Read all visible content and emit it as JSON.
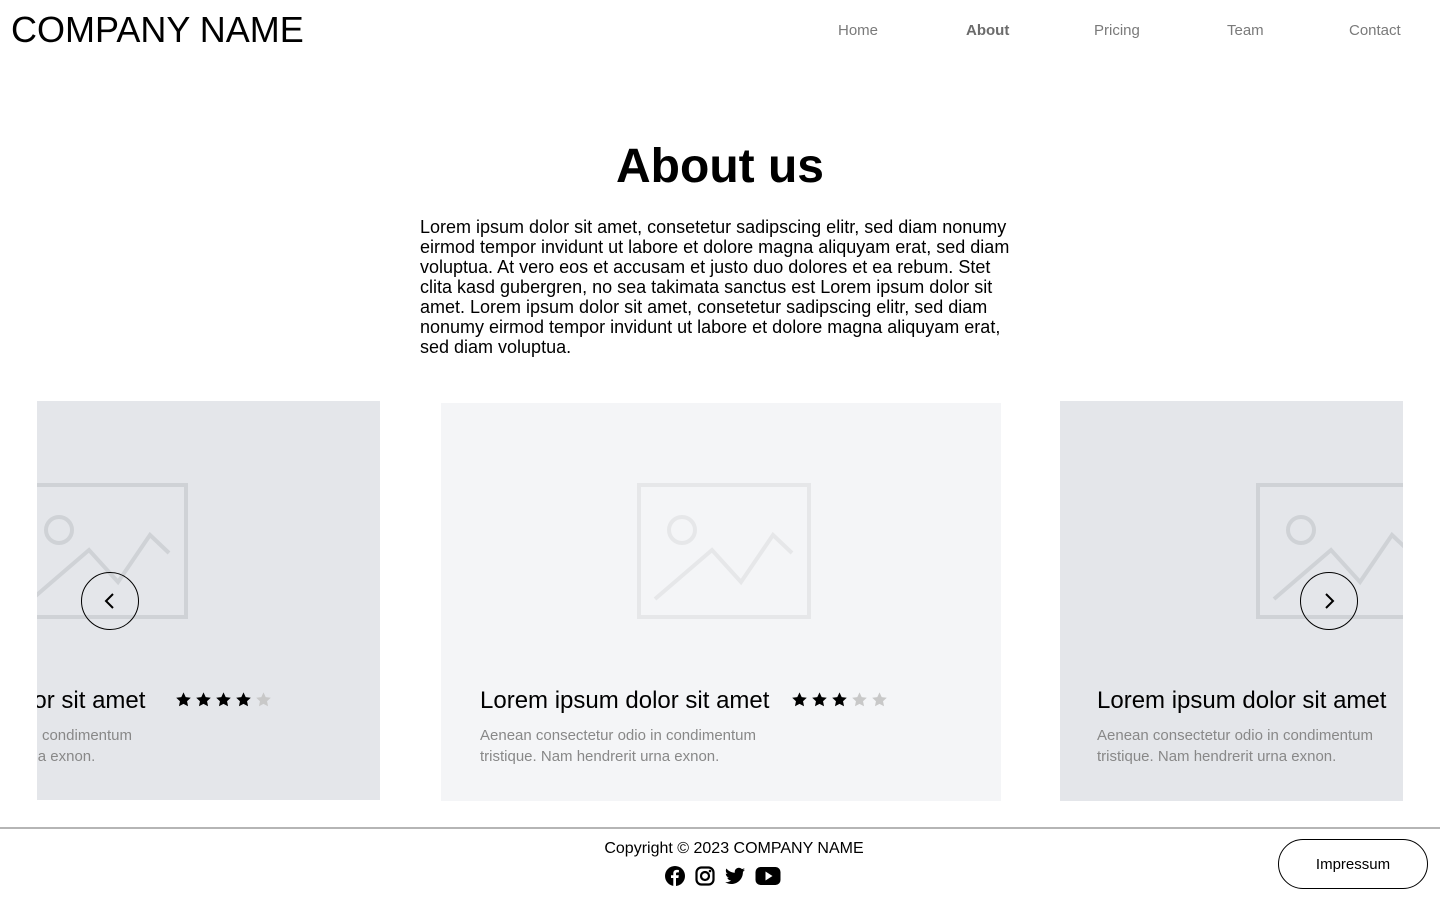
{
  "header": {
    "brand": "COMPANY NAME",
    "nav": [
      {
        "label": "Home",
        "active": false
      },
      {
        "label": "About",
        "active": true
      },
      {
        "label": "Pricing",
        "active": false
      },
      {
        "label": "Team",
        "active": false
      },
      {
        "label": "Contact",
        "active": false
      }
    ]
  },
  "main": {
    "title": "About us",
    "intro": "Lorem ipsum dolor sit amet, consetetur sadipscing elitr, sed diam nonumy eirmod tempor invidunt ut labore et dolore magna aliquyam erat, sed diam voluptua. At vero eos et accusam et justo duo dolores et ea rebum. Stet clita kasd gubergren, no sea takimata sanctus est Lorem ipsum dolor sit amet. Lorem ipsum dolor sit amet, consetetur sadipscing elitr, sed diam nonumy eirmod tempor invidunt ut labore et dolore magna aliquyam erat, sed diam voluptua."
  },
  "carousel": {
    "cards": [
      {
        "title": "Lorem ipsum dolor sit amet",
        "text": "Aenean consectetur odio in condimentum tristique. Nam hendrerit urna exnon.",
        "rating": 4,
        "max_rating": 5
      },
      {
        "title": "Lorem ipsum dolor sit amet",
        "text": "Aenean consectetur odio in condimentum tristique. Nam hendrerit urna exnon.",
        "rating": 3,
        "max_rating": 5
      },
      {
        "title": "Lorem ipsum dolor sit amet",
        "text": "Aenean consectetur odio in condimentum tristique. Nam hendrerit urna exnon.",
        "rating": null,
        "max_rating": 5
      }
    ],
    "prev_icon": "chevron-left-icon",
    "next_icon": "chevron-right-icon"
  },
  "footer": {
    "copyright": "Copyright © 2023 COMPANY NAME",
    "social": [
      "facebook-icon",
      "instagram-icon",
      "twitter-icon",
      "youtube-icon"
    ],
    "impressum_label": "Impressum"
  },
  "colors": {
    "side_card": "#e4e6ea",
    "center_card": "#f4f5f7",
    "star_filled": "#000000",
    "star_empty": "#c8c8c8",
    "muted_text": "#888888"
  }
}
